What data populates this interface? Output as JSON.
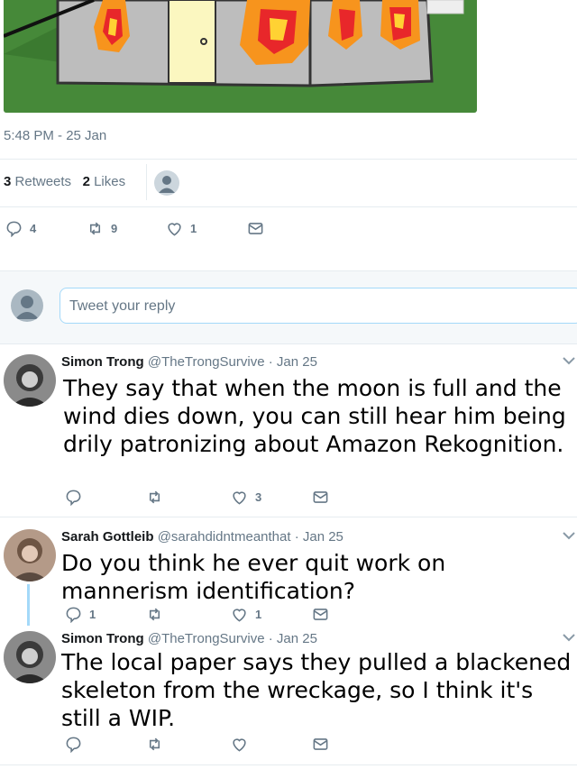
{
  "tweet": {
    "timestamp": "5:48 PM - 25 Jan",
    "stats": {
      "retweets_count": "3",
      "retweets_label": "Retweets",
      "likes_count": "2",
      "likes_label": "Likes"
    },
    "actions": {
      "replies": "4",
      "retweets": "9",
      "likes": "1"
    }
  },
  "reply_box": {
    "placeholder": "Tweet your reply"
  },
  "replies": [
    {
      "name": "Simon Trong",
      "handle": "@TheTrongSurvive",
      "date": "· Jan 25",
      "text": "They say that when the moon is full and the wind dies down, you can still hear him being drily patronizing about Amazon Rekognition.",
      "reply_count": "",
      "retweet_count": "",
      "like_count": "3"
    },
    {
      "name": "Sarah Gottleib",
      "handle": "@sarahdidntmeanthat",
      "date": "· Jan 25",
      "text": "Do you think he ever quit work on mannerism identification?",
      "reply_count": "1",
      "retweet_count": "",
      "like_count": "1"
    },
    {
      "name": "Simon Trong",
      "handle": "@TheTrongSurvive",
      "date": "· Jan 25",
      "text": "The local paper says they pulled a blackened skeleton from the wreckage, so I think it's still a WIP.",
      "reply_count": "",
      "retweet_count": "",
      "like_count": ""
    }
  ],
  "colors": {
    "text_secondary": "#657786",
    "divider": "#e6ecf0",
    "input_border": "#a4d9f9",
    "grass": "#3f8a36",
    "fire": "#f7941d"
  },
  "icons": [
    "reply-icon",
    "retweet-icon",
    "like-icon",
    "message-icon",
    "chevron-down-icon"
  ]
}
